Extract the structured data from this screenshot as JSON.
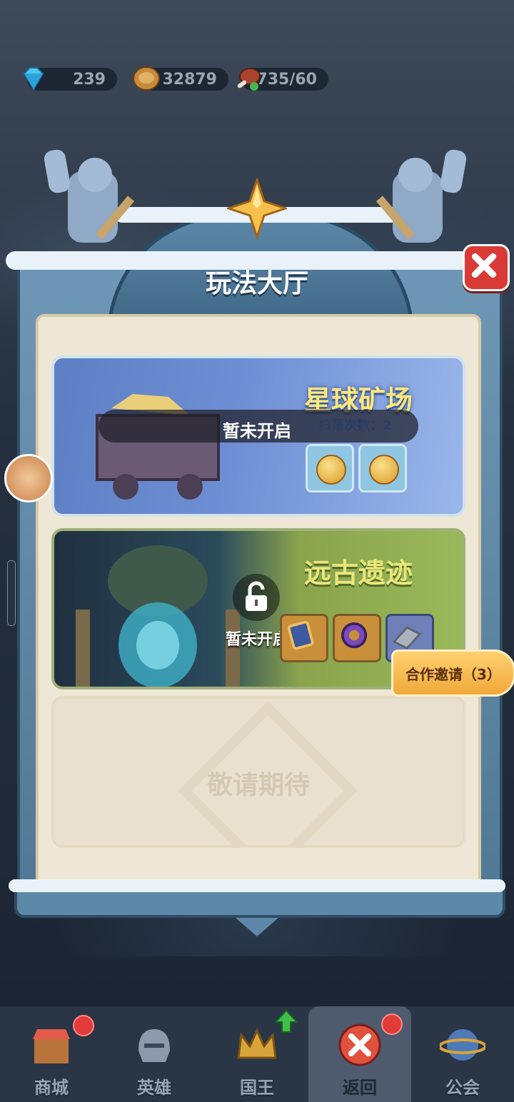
{
  "resources": {
    "gems": "239",
    "gold": "32879",
    "stamina": "1735/60"
  },
  "panel": {
    "title": "玩法大厅"
  },
  "cards": {
    "mine": {
      "title": "星球矿场",
      "locked_label": "暂未开启",
      "sweep_label": "扫荡次数：2"
    },
    "ruins": {
      "title": "远古遗迹",
      "locked_label": "暂未开启"
    },
    "coming_soon": {
      "label": "敬请期待"
    }
  },
  "coop_button": {
    "label": "合作邀请（3）"
  },
  "nav": {
    "items": [
      {
        "label": "商城"
      },
      {
        "label": "英雄"
      },
      {
        "label": "国王"
      },
      {
        "label": "返回"
      },
      {
        "label": "公会"
      }
    ]
  },
  "colors": {
    "close_red": "#d93a35",
    "notification_red": "#e33a3a",
    "coop_orange": "#f0a83a",
    "mine_title_yellow": "#ffe77a",
    "ruins_title_yellow": "#e9e77a"
  }
}
